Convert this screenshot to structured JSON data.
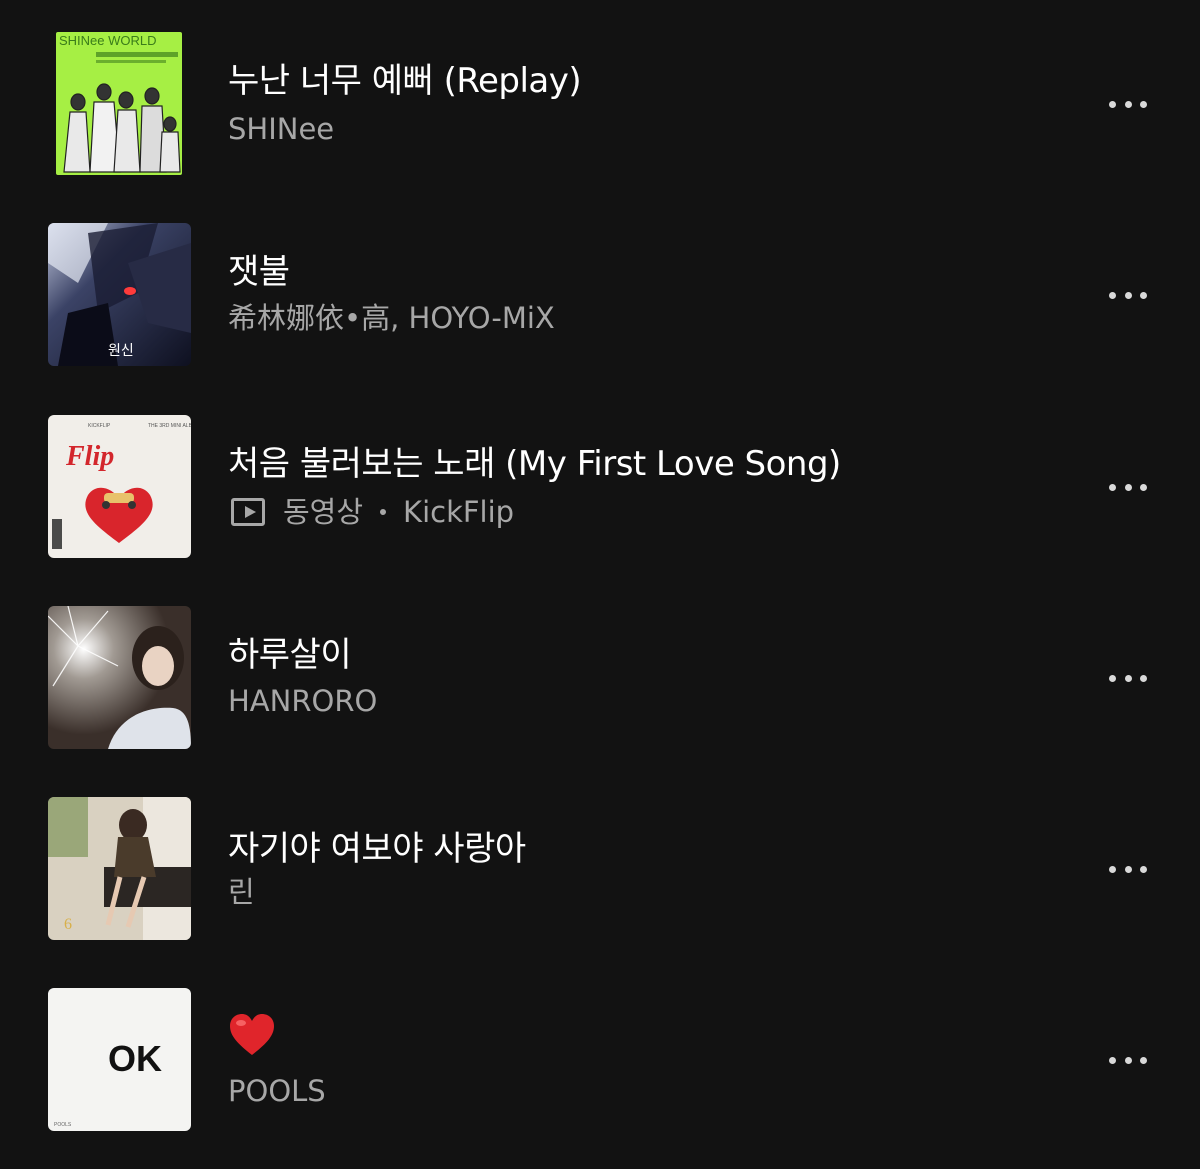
{
  "tracks": [
    {
      "title": "누난 너무 예뻐 (Replay)",
      "artist": "SHINee",
      "art_text": "SHINee WORLD",
      "art_icon": "album-art-shinee-world"
    },
    {
      "title": "잿불",
      "artist": "希林娜依•高, HOYO-MiX",
      "art_text": "원신",
      "art_icon": "album-art-genshin"
    },
    {
      "title": "처음 불러보는 노래 (My First Love Song)",
      "badge": "동영상",
      "artist": "KickFlip",
      "art_text": "Flip",
      "art_icon": "album-art-kickflip"
    },
    {
      "title": "하루살이",
      "artist": "HANRORO",
      "art_icon": "album-art-hanroro"
    },
    {
      "title": "자기야 여보야 사랑아",
      "artist": "린",
      "art_text": "6",
      "art_icon": "album-art-lyn"
    },
    {
      "title_icon": "red-heart-emoji",
      "artist": "POOLS",
      "art_text": "OK",
      "art_icon": "album-art-pools-ok"
    }
  ],
  "colors": {
    "background": "#121212",
    "title": "#ffffff",
    "subtitle": "#a7a7a7",
    "more_dots": "#d9d9d9",
    "shinee_green": "#9be83b",
    "heart_red": "#e0252b"
  },
  "icons": {
    "more": "more-horizontal-icon",
    "video": "video-play-icon"
  }
}
